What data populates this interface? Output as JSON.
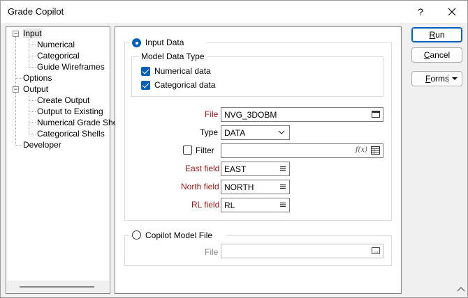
{
  "window": {
    "title": "Grade Copilot",
    "help_label": "?",
    "help_icon": "question-mark",
    "close_icon": "x-close"
  },
  "tree": {
    "items": [
      {
        "label": "Input",
        "expander": "−"
      },
      {
        "label": "Numerical"
      },
      {
        "label": "Categorical"
      },
      {
        "label": "Guide Wireframes"
      },
      {
        "label": "Options"
      },
      {
        "label": "Output",
        "expander": "−"
      },
      {
        "label": "Create Output"
      },
      {
        "label": "Output to Existing"
      },
      {
        "label": "Numerical Grade Shell"
      },
      {
        "label": "Categorical Shells"
      },
      {
        "label": "Developer"
      }
    ]
  },
  "input_data": {
    "radio_label": "Input Data",
    "selected": true,
    "model_data_type": {
      "legend": "Model Data Type",
      "numerical_label": "Numerical data",
      "numerical_checked": true,
      "categorical_label": "Categorical data",
      "categorical_checked": true
    },
    "file": {
      "label": "File",
      "value": "NVG_3DOBM"
    },
    "type": {
      "label": "Type",
      "value": "DATA"
    },
    "filter": {
      "label": "Filter",
      "checked": false,
      "value": "",
      "fx_label": "f(x)"
    },
    "east_field": {
      "label": "East field",
      "value": "EAST"
    },
    "north_field": {
      "label": "North field",
      "value": "NORTH"
    },
    "rl_field": {
      "label": "RL field",
      "value": "RL"
    }
  },
  "copilot_model": {
    "radio_label": "Copilot Model File",
    "selected": false,
    "file": {
      "label": "File",
      "value": ""
    }
  },
  "buttons": {
    "run_label_u": "R",
    "run_label_rest": "un",
    "cancel_label_u": "C",
    "cancel_label_rest": "ancel",
    "forms_label_u": "F",
    "forms_label_rest": "orms"
  },
  "colors": {
    "accent": "#005fb8",
    "required_label": "#8b1a1a"
  }
}
